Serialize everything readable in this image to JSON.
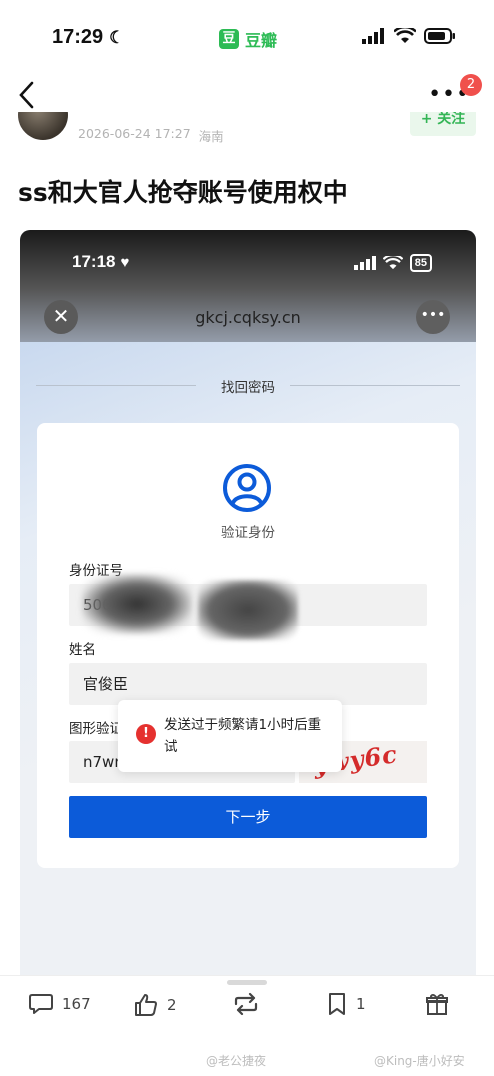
{
  "status_bar": {
    "time": "17:29",
    "app_badge": "豆",
    "app_name": "豆瓣"
  },
  "nav": {
    "notification_count": "2"
  },
  "post": {
    "date": "2026-06-24 17:27",
    "location": "海南",
    "follow_label": "+ 关注",
    "title": "ss和大官人抢夺账号使用权中"
  },
  "screenshot": {
    "time": "17:18",
    "battery": "85",
    "url": "gkcj.cqksy.cn",
    "page_heading": "找回密码",
    "verify_title": "验证身份",
    "id_label": "身份证号",
    "id_value": "500",
    "name_label": "姓名",
    "name_value": "官俊臣",
    "captcha_label": "图形验证码",
    "captcha_value": "n7wn",
    "captcha_image_text": "ywy6c",
    "next_button": "下一步",
    "toast": "发送过于频繁请1小时后重试"
  },
  "actions": {
    "comments": "167",
    "likes": "2",
    "reposts": "",
    "collects": "1"
  },
  "watermarks": {
    "left": "@老公捷夜",
    "right": "@King-唐小好安"
  },
  "colors": {
    "brand": "#2dbb55",
    "primary_button": "#0c5bd9",
    "error": "#e5312f",
    "badge": "#f0504c"
  }
}
